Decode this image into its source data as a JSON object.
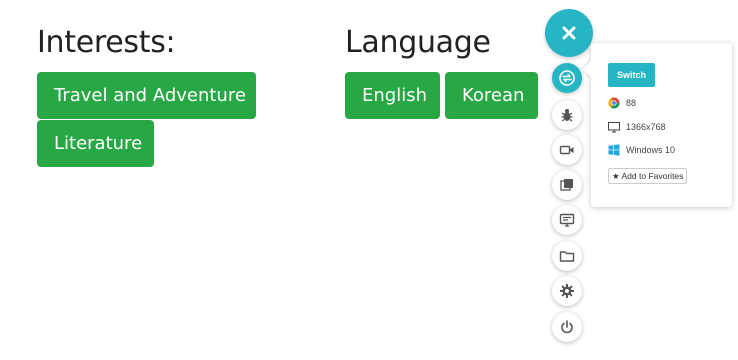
{
  "interests": {
    "title": "Interests:",
    "tags": [
      "Travel and Adventure",
      "Literature"
    ]
  },
  "language": {
    "title": "Language",
    "tags": [
      "English",
      "Korean"
    ]
  },
  "panel": {
    "switch_label": "Switch",
    "browser_version": "88",
    "resolution": "1366x768",
    "os": "Windows 10",
    "favorite_label": "★ Add to Favorites"
  },
  "toolbar_icons": [
    "close-icon",
    "switch-icon",
    "bug-icon",
    "video-icon",
    "screenshots-icon",
    "display-icon",
    "folder-icon",
    "gear-icon",
    "power-icon"
  ],
  "colors": {
    "tag_green": "#28a745",
    "accent_teal": "#26b5c4"
  }
}
